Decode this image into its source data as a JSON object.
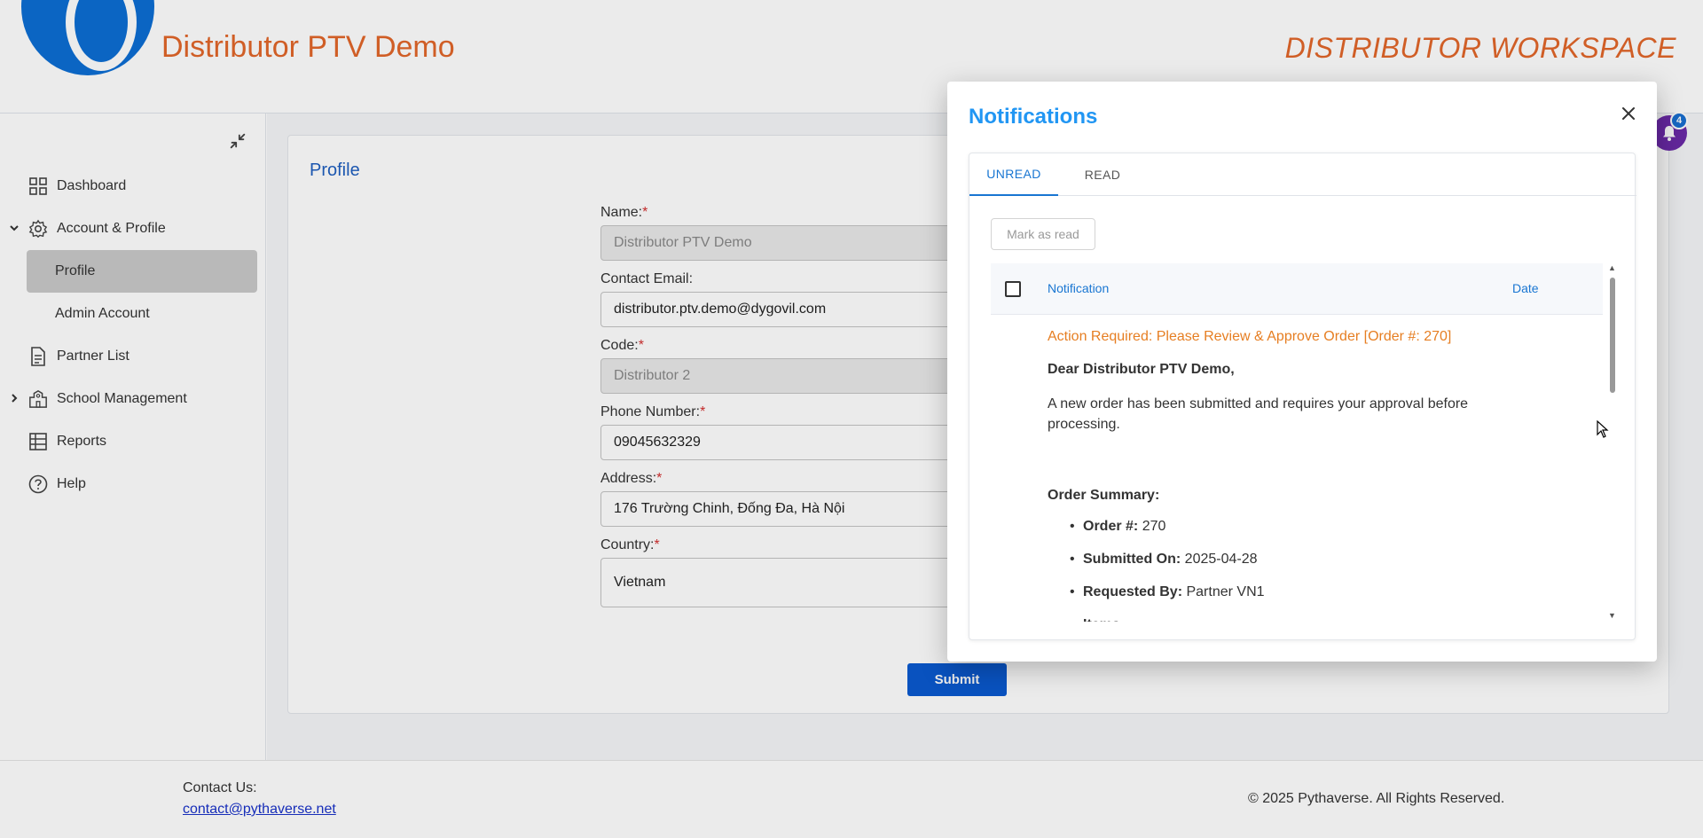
{
  "header": {
    "brand": "Distributor PTV Demo",
    "workspace": "DISTRIBUTOR WORKSPACE"
  },
  "sidebar": {
    "items": [
      {
        "label": "Dashboard",
        "icon": "dashboard-icon"
      },
      {
        "label": "Account & Profile",
        "icon": "gear-icon"
      },
      {
        "label": "Profile"
      },
      {
        "label": "Admin Account"
      },
      {
        "label": "Partner List",
        "icon": "document-icon"
      },
      {
        "label": "School Management",
        "icon": "school-icon"
      },
      {
        "label": "Reports",
        "icon": "table-icon"
      },
      {
        "label": "Help",
        "icon": "help-icon"
      }
    ]
  },
  "profile": {
    "title": "Profile",
    "fields": {
      "name": {
        "label": "Name:",
        "value": "Distributor PTV Demo"
      },
      "email": {
        "label": "Contact Email:",
        "value": "distributor.ptv.demo@dygovil.com"
      },
      "code": {
        "label": "Code:",
        "value": "Distributor 2"
      },
      "phone": {
        "label": "Phone Number:",
        "value": "09045632329"
      },
      "address": {
        "label": "Address:",
        "value": "176 Trường Chinh, Đống Đa, Hà Nội"
      },
      "country": {
        "label": "Country:",
        "value": "Vietnam"
      }
    },
    "required_mark": "*",
    "submit": "Submit"
  },
  "footer": {
    "contact_label": "Contact Us:",
    "contact_email": "contact@pythaverse.net",
    "copyright": "© 2025 Pythaverse. All Rights Reserved."
  },
  "bell": {
    "count": "4"
  },
  "notifications": {
    "title": "Notifications",
    "tabs": {
      "unread": "UNREAD",
      "read": "READ"
    },
    "mark_as_read": "Mark as read",
    "columns": {
      "notification": "Notification",
      "date": "Date"
    },
    "item": {
      "subject": "Action Required: Please Review & Approve Order [Order #: 270]",
      "greeting": "Dear Distributor PTV Demo,",
      "paragraph": "A new order has been submitted and requires your approval before processing.",
      "summary_title": "Order Summary:",
      "summary": [
        {
          "key": "Order #:",
          "value": "270"
        },
        {
          "key": "Submitted On:",
          "value": "2025-04-28"
        },
        {
          "key": "Requested By:",
          "value": "Partner VN1"
        },
        {
          "key": "Items:",
          "value": ""
        }
      ]
    }
  },
  "colors": {
    "brand": "#e2662a",
    "primary": "#1976d2",
    "title_blue": "#2196f3",
    "subject_orange": "#e67e22",
    "submit_blue": "#0a5ad0",
    "bell_purple": "#6b2aa8"
  }
}
